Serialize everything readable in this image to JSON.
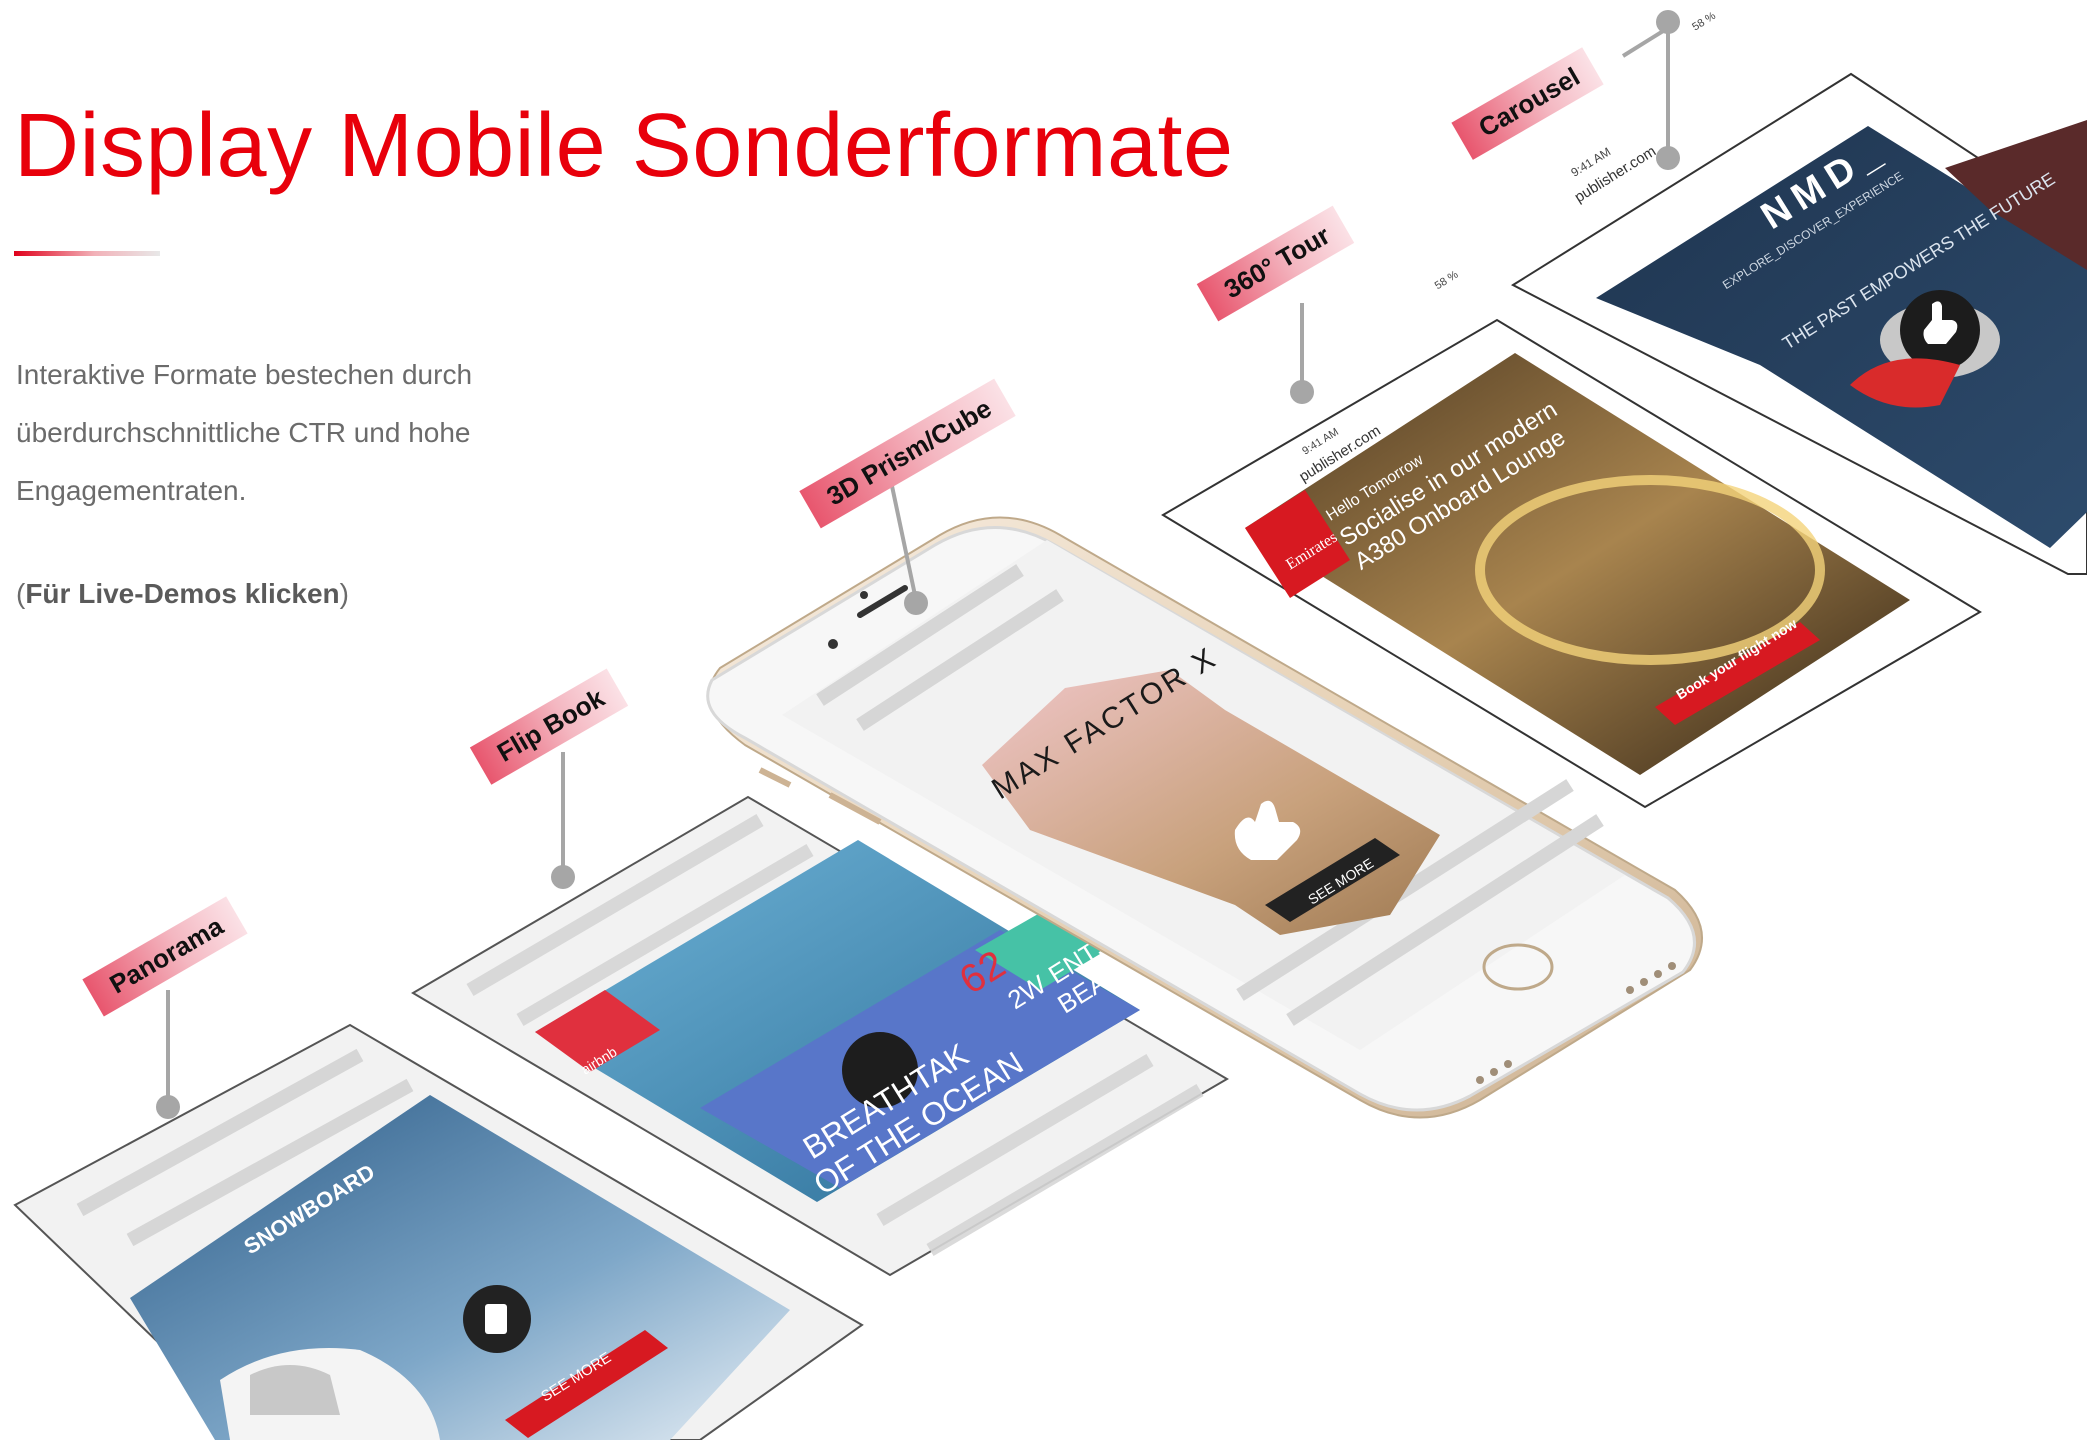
{
  "page": {
    "title": "Display Mobile Sonderformate",
    "intro_lines": [
      "Interaktive Formate bestechen durch",
      "überdurchschnittliche CTR und hohe",
      "Engagementraten."
    ],
    "demo_open": "(",
    "demo_bold": "Für Live-Demos klicken",
    "demo_close": ")"
  },
  "formats": [
    {
      "label": "Panorama"
    },
    {
      "label": "Flip Book"
    },
    {
      "label": "3D Prism/Cube"
    },
    {
      "label": "360° Tour"
    },
    {
      "label": "Carousel"
    }
  ],
  "ads": {
    "panorama": {
      "headline": "SNOWBOARD",
      "cta": "SEE MORE"
    },
    "flipbook": {
      "brand": "airbnb",
      "headline_1": "BREATHTAK",
      "headline_2": "OF THE OCEAN",
      "side_1": "2W",
      "side_2": "ENTS",
      "side_3": "BEACH",
      "number": "62"
    },
    "prism": {
      "brand": "MAX FACTOR X",
      "cta": "SEE MORE"
    },
    "tour": {
      "time": "9:41 AM",
      "url": "publisher.com",
      "battery": "58 %",
      "brand": "Emirates",
      "greeting": "Hello Tomorrow",
      "headline_1": "Socialise in our modern",
      "headline_2": "A380 Onboard Lounge",
      "cta": "Book your flight now"
    },
    "carousel": {
      "time": "9:41 AM",
      "url": "publisher.com",
      "battery": "58 %",
      "brand": "NMD_",
      "sub": "EXPLORE_DISCOVER_EXPERIENCE",
      "tagline": "THE PAST EMPOWERS THE FUTURE"
    }
  },
  "colors": {
    "brand_red": "#e8000b",
    "text_grey": "#6b6b6b",
    "tag_pink": "#e8566e",
    "pin_grey": "#a6a6a6",
    "phone_gold": "#e9d7bf"
  }
}
